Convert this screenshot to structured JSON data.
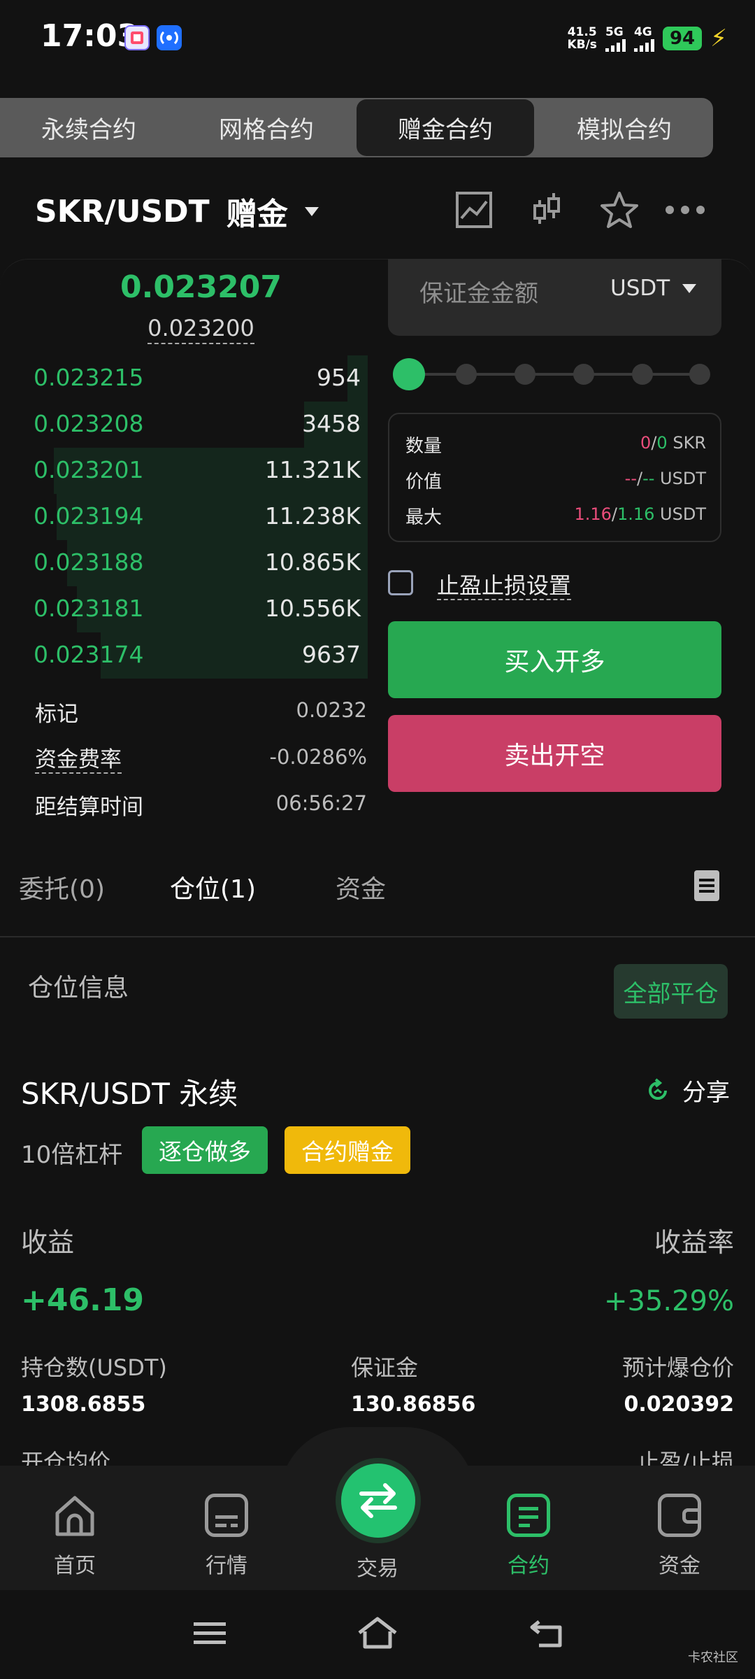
{
  "status_bar": {
    "time": "17:03",
    "net_speed_value": "41.5",
    "net_speed_unit": "KB/s",
    "sig1": "5G",
    "sig2": "4G",
    "battery": "94"
  },
  "top_tabs": [
    {
      "label": "永续合约",
      "active": false
    },
    {
      "label": "网格合约",
      "active": false
    },
    {
      "label": "赠金合约",
      "active": true
    },
    {
      "label": "模拟合约",
      "active": false
    }
  ],
  "pair": {
    "symbol": "SKR/USDT",
    "tag": "赠金"
  },
  "price": {
    "last": "0.023207",
    "index": "0.023200"
  },
  "order_book": [
    {
      "price": "0.023215",
      "qty": "954",
      "depth": 0.06
    },
    {
      "price": "0.023208",
      "qty": "3458",
      "depth": 0.19
    },
    {
      "price": "0.023201",
      "qty": "11.321K",
      "depth": 0.94
    },
    {
      "price": "0.023194",
      "qty": "11.238K",
      "depth": 0.93
    },
    {
      "price": "0.023188",
      "qty": "10.865K",
      "depth": 0.9
    },
    {
      "price": "0.023181",
      "qty": "10.556K",
      "depth": 0.87
    },
    {
      "price": "0.023174",
      "qty": "9637",
      "depth": 0.8
    }
  ],
  "stats": {
    "mark_label": "标记",
    "mark_value": "0.0232",
    "funding_label": "资金费率",
    "funding_value": "-0.0286%",
    "settle_label": "距结算时间",
    "settle_value": "06:56:27"
  },
  "margin": {
    "placeholder": "保证金金额",
    "unit": "USDT",
    "slider_percent": 0
  },
  "info": {
    "qty_label": "数量",
    "qty_a": "0",
    "qty_b": "0",
    "qty_unit": "SKR",
    "value_label": "价值",
    "value_a": "--",
    "value_b": "--",
    "value_unit": "USDT",
    "max_label": "最大",
    "max_a": "1.16",
    "max_b": "1.16",
    "max_unit": "USDT",
    "sep": "/"
  },
  "tp_sl_label": "止盈止损设置",
  "buy_label": "买入开多",
  "sell_label": "卖出开空",
  "order_tabs": [
    {
      "label": "委托(0)",
      "active": false
    },
    {
      "label": "仓位(1)",
      "active": true
    },
    {
      "label": "资金",
      "active": false
    }
  ],
  "position": {
    "section_label": "仓位信息",
    "close_all": "全部平仓",
    "title": "SKR/USDT 永续",
    "share": "分享",
    "leverage": "10倍杠杆",
    "tag_mode": "逐仓做多",
    "tag_bonus": "合约赠金",
    "pnl_label": "收益",
    "pnl_value": "+46.19",
    "pnl_rate_label": "收益率",
    "pnl_rate_value": "+35.29%",
    "size_label": "持仓数(USDT)",
    "size_value": "1308.6855",
    "margin_label": "保证金",
    "margin_value": "130.86856",
    "liq_label": "预计爆仓价",
    "liq_value": "0.020392",
    "entry_label": "开仓均价",
    "tpsl_label": "止盈/止损"
  },
  "bottom_nav": [
    {
      "label": "首页",
      "icon": "home-icon",
      "active": false
    },
    {
      "label": "行情",
      "icon": "market-icon",
      "active": false
    },
    {
      "label": "交易",
      "icon": "swap-icon",
      "active": false
    },
    {
      "label": "合约",
      "icon": "contract-icon",
      "active": true
    },
    {
      "label": "资金",
      "icon": "wallet-icon",
      "active": false
    }
  ],
  "watermark": "卡农社区",
  "colors": {
    "green": "#2dbf68",
    "red": "#c93e66",
    "yellow": "#f0b90b",
    "bg": "#121212"
  }
}
